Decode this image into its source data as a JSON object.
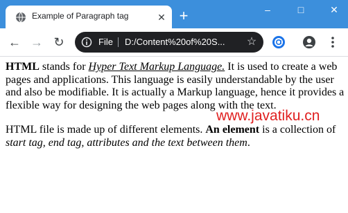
{
  "tab": {
    "title": "Example of Paragraph tag",
    "close_glyph": "✕",
    "icon": "globe-icon"
  },
  "new_tab_glyph": "+",
  "window_controls": {
    "minimize": "–",
    "maximize": "□",
    "close": "✕"
  },
  "toolbar": {
    "back_glyph": "←",
    "forward_glyph": "→",
    "reload_glyph": "↻",
    "scheme_label": "File",
    "url": "D:/Content%20of%20S...",
    "star_glyph": "☆"
  },
  "colors": {
    "tabbar": "#3c8fdc",
    "omnibox": "#202124",
    "watermark": "#e02020"
  },
  "content": {
    "p1_html": "<b>HTML</b> stands for <i><u>Hyper Text Markup Language.</u></i> It is used to create a web pages and applications. This language is easily understandable by the user and also be modifiable. It is actually a Markup language, hence it provides a flexible way for designing the web pages along with the text.",
    "p2_html": "HTML file is made up of different elements. <b>An element</b> is a collection of <i>start tag, end tag, attributes and the text between them</i>."
  },
  "watermark": "www.javatiku.cn"
}
